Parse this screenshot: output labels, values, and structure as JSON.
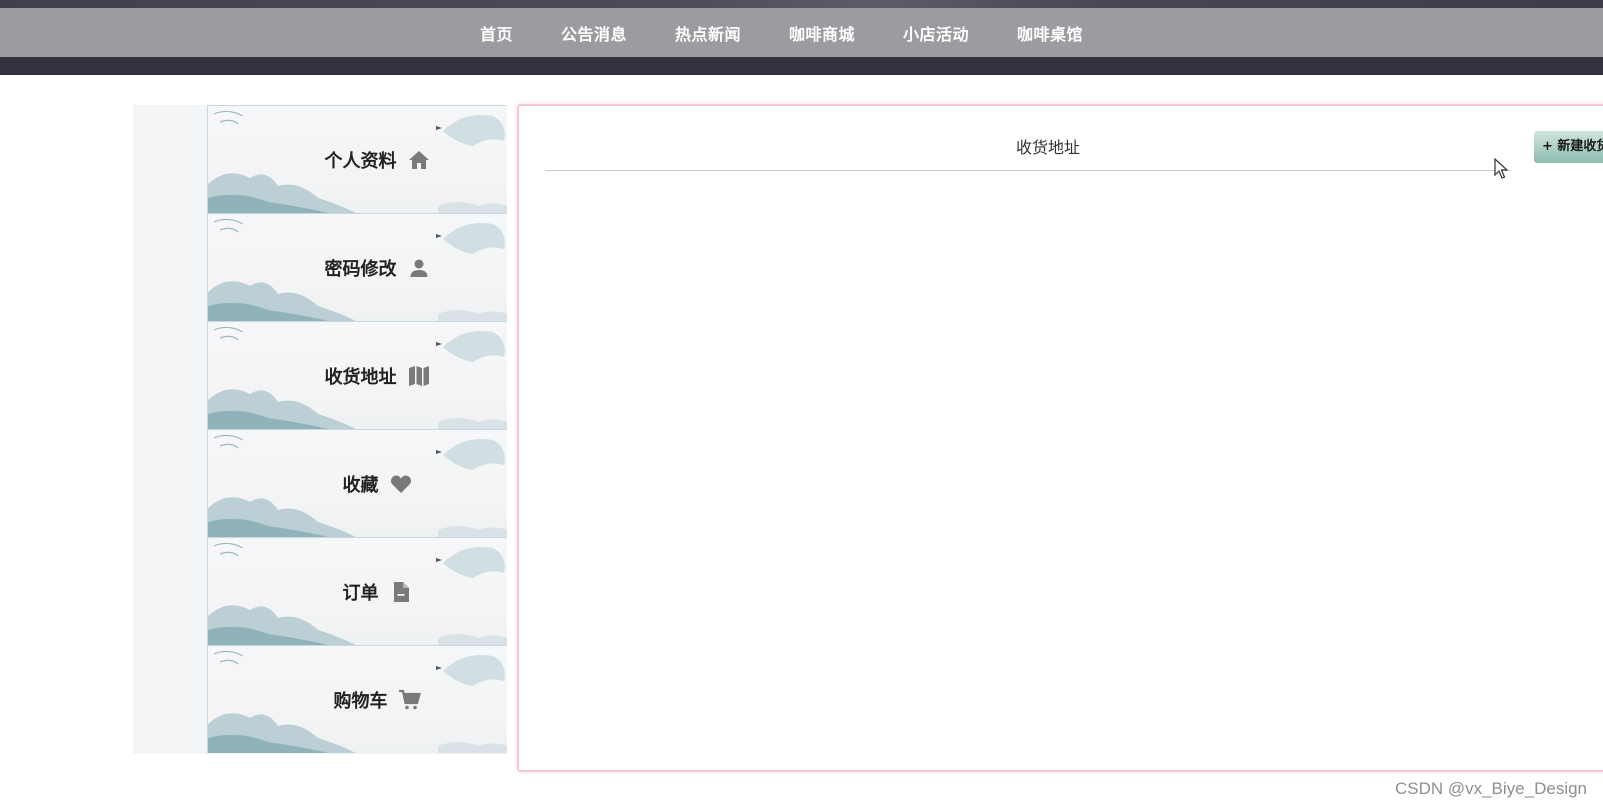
{
  "nav": {
    "items": [
      {
        "label": "首页"
      },
      {
        "label": "公告消息"
      },
      {
        "label": "热点新闻"
      },
      {
        "label": "咖啡商城"
      },
      {
        "label": "小店活动"
      },
      {
        "label": "咖啡桌馆"
      }
    ]
  },
  "sidebar": {
    "items": [
      {
        "label": "个人资料",
        "icon": "home-icon"
      },
      {
        "label": "密码修改",
        "icon": "user-icon"
      },
      {
        "label": "收货地址",
        "icon": "map-icon"
      },
      {
        "label": "收藏",
        "icon": "heart-icon"
      },
      {
        "label": "订单",
        "icon": "file-icon"
      },
      {
        "label": "购物车",
        "icon": "cart-icon"
      }
    ]
  },
  "main": {
    "title": "收货地址",
    "new_button_label": "+ 新建收货"
  },
  "watermark": "CSDN @vx_Biye_Design",
  "colors": {
    "navbar": "#9c9b9f",
    "nav_dark": "#32323f",
    "panel_border": "#f5c9d2",
    "button_teal": "#a9cdc3",
    "icon_gray": "#7a7a7a"
  }
}
